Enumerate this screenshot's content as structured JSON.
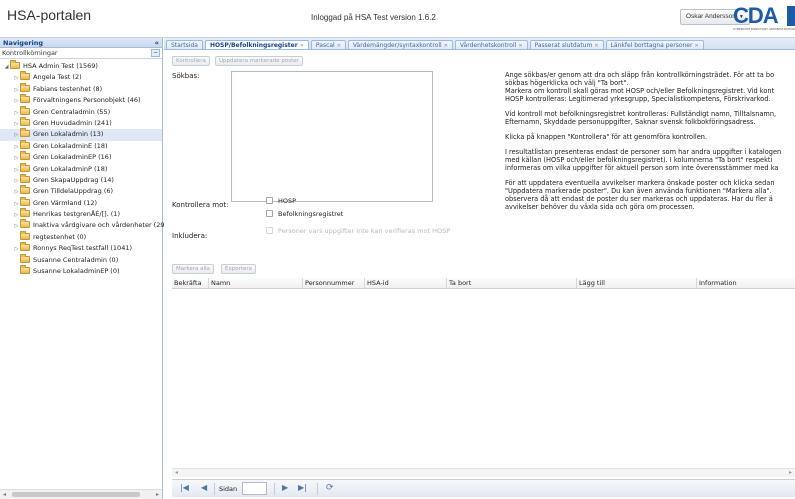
{
  "header": {
    "app_title": "HSA-portalen",
    "login_info": "Inloggad på HSA Test version 1.6.2",
    "user_name": "Oskar Andersson",
    "logo_text": "CDA",
    "logo_subtitle": "CYBERCOM DIRECTORY ADMINISTRATION"
  },
  "nav": {
    "header": "Navigering",
    "subheader": "Kontrollkörningar",
    "tree": [
      {
        "label": "HSA Admin Test (1569)",
        "level": 0,
        "expanded": true
      },
      {
        "label": "Angela Test (2)",
        "level": 1
      },
      {
        "label": "Fabians testenhet (8)",
        "level": 1
      },
      {
        "label": "Förvaltningens Personobjekt (46)",
        "level": 1
      },
      {
        "label": "Gren Centraladmin (55)",
        "level": 1
      },
      {
        "label": "Gren Huvudadmin (241)",
        "level": 1
      },
      {
        "label": "Gren Lokaladmin (13)",
        "level": 1,
        "selected": true
      },
      {
        "label": "Gren LokaladminE (18)",
        "level": 1
      },
      {
        "label": "Gren LokaladminEP (16)",
        "level": 1
      },
      {
        "label": "Gren LokaladminP (18)",
        "level": 1
      },
      {
        "label": "Gren SkapaUppdrag (14)",
        "level": 1
      },
      {
        "label": "Gren TilldelaUppdrag (6)",
        "level": 1
      },
      {
        "label": "Gren Värmland (12)",
        "level": 1
      },
      {
        "label": "Henrikas testgrenÅÉ/[]. (1)",
        "level": 1
      },
      {
        "label": "Inaktiva vårdgivare och vårdenheter (29",
        "level": 1
      },
      {
        "label": "regtestenhet (0)",
        "level": 1,
        "leaf": true
      },
      {
        "label": "Ronnys ReqTest testfall (1041)",
        "level": 1
      },
      {
        "label": "Susanne Centraladmin (0)",
        "level": 1,
        "leaf": true
      },
      {
        "label": "Susanne LokaladminEP (0)",
        "level": 1,
        "leaf": true
      }
    ]
  },
  "tabs": [
    {
      "label": "Startsida",
      "closable": false,
      "active": false
    },
    {
      "label": "HOSP/Befolkningsregister",
      "closable": true,
      "active": true
    },
    {
      "label": "Pascal",
      "closable": true,
      "active": false
    },
    {
      "label": "Värdemängder/syntaxkontroll",
      "closable": true,
      "active": false
    },
    {
      "label": "Vårdenhetskontroll",
      "closable": true,
      "active": false
    },
    {
      "label": "Passerat slutdatum",
      "closable": true,
      "active": false
    },
    {
      "label": "Länkfel borttagna personer",
      "closable": true,
      "active": false
    }
  ],
  "toolbar": {
    "check_button": "Kontrollera",
    "update_marked_button": "Uppdatera markerade poster"
  },
  "form": {
    "search_label": "Sökbas:",
    "check_against_label": "Kontrollera mot:",
    "hosp_option": "HOSP",
    "population_option": "Befolkningsregistret",
    "include_label": "Inkludera:",
    "include_option": "Personer vars uppgifter inte kan verifieras mot HOSP"
  },
  "help_text": [
    "Ange sökbas/er genom att dra och släpp från kontrollkörningsträdet. För att ta bo",
    "sökbas högerklicka och välj \"Ta bort\".",
    "Markera om kontroll skall göras mot HOSP och/eller Befolkningsregistret. Vid kont",
    "HOSP kontrolleras: Legitimerad yrkesgrupp, Specialistkompetens, Förskrivarkod.",
    "Vid kontroll mot befolkningsregistret kontrolleras: Fullständigt namn, Tilltalsnamn,",
    "Efternamn, Skyddade personuppgifter, Saknar svensk folkbokföringsadress.",
    "Klicka på knappen \"Kontrollera\" för att genomföra kontrollen.",
    "I resultatlistan presenteras endast de personer som har andra uppgifter i katalogen",
    "med källan (HOSP och/eller befolkningsregistret). I kolumnerna \"Ta bort\" respekti",
    "informeras om vilka uppgifter för aktuell person som inte överensstämmer med ka",
    "För att uppdatera eventuella avvikelser markera önskade poster och klicka sedan",
    "\"Uppdatera markerade poster\". Du kan även använda funktionen \"Markera alla\".",
    "observera då att endast de poster du ser markeras och uppdateras. Har du fler ä",
    "avvikelser behöver du växla sida och göra om processen."
  ],
  "grid": {
    "mark_all_button": "Markera alla",
    "export_button": "Exportera",
    "columns": [
      "Bekräfta",
      "Namn",
      "Personnummer",
      "HSA-id",
      "Ta bort",
      "Lägg till",
      "Information"
    ]
  },
  "pager": {
    "page_label": "Sidan",
    "page_value": ""
  }
}
